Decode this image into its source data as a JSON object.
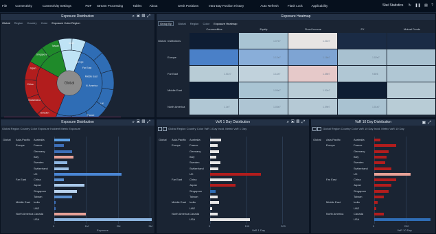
{
  "menu": [
    "File",
    "Connectivity",
    "Connectivity Settings",
    "PDF",
    "Stream Processing",
    "Tables",
    "About",
    "",
    "Desk Positions",
    "Intra-Day Position History",
    "Auto Refresh",
    "Flash Lock",
    "Applicability"
  ],
  "top_right": {
    "label": "Stat Statistics",
    "icons": [
      "refresh-icon",
      "pause-icon",
      "chart-icon",
      "help-icon"
    ]
  },
  "p1": {
    "title": "Exposure Distribution",
    "controls": {
      "items": [
        "Global",
        "Region",
        "Country"
      ],
      "color_label": "Color",
      "color_value": "Exposure Color Region"
    }
  },
  "sunburst": {
    "center": "Global",
    "regions": [
      {
        "name": "Europe",
        "value": 50,
        "color": "#2f6db5"
      },
      {
        "name": "Far East",
        "value": 27,
        "color": "#b21d1d"
      },
      {
        "name": "Middle East",
        "value": 13,
        "color": "#1f8a2a"
      },
      {
        "name": "North America",
        "value": 10,
        "color": "#bfe3f5"
      }
    ],
    "outer_labels": [
      "Europe",
      "Far East",
      "Middle East",
      "N. America",
      "UK",
      "France",
      "Germany",
      "Italy",
      "Sweden",
      "Switzerland",
      "China",
      "Japan",
      "Singapore",
      "Taiwan",
      "Israel"
    ]
  },
  "p2": {
    "title": "Exposure Heatmap",
    "controls": {
      "select": "Group By",
      "items": [
        "Global",
        "Region"
      ],
      "color_label": "Color",
      "color_value": "Exposure Heatmap"
    },
    "columns": [
      "Commodities",
      "Equity",
      "Fixed Income",
      "FX",
      "Mutual Funds"
    ],
    "rows": [
      {
        "group": "Global",
        "label": "Institutions",
        "cells": [
          "#0e1d33",
          "#a9c4d3",
          "#e7e4e3",
          "#1a2b45",
          "#1a2b45"
        ],
        "vals": [
          "",
          "1.07e7",
          "1.21e7",
          "",
          ""
        ]
      },
      {
        "group": "",
        "label": "Europe",
        "cells": [
          "#4a80c8",
          "#89aed9",
          "#7ea4d3",
          "#a8c1d0",
          "#a8c1d0"
        ],
        "vals": [
          "",
          "1.12e7",
          "1.18e7",
          "1.02e7",
          ""
        ]
      },
      {
        "group": "",
        "label": "Far East",
        "cells": [
          "#b8ccd6",
          "#c1d2dc",
          "#e6c9c9",
          "#b0c7d4",
          "#b0c7d4"
        ],
        "vals": [
          "1.01e7",
          "1.11e7",
          "1.35e7",
          "9.8e6",
          ""
        ]
      },
      {
        "group": "",
        "label": "Middle East",
        "cells": [
          "#0e1d33",
          "#a9c4d3",
          "#b9ccd6",
          "#0e1d33",
          "#b8ccd6"
        ],
        "vals": [
          "",
          "1.05e7",
          "1.02e7",
          "",
          ""
        ]
      },
      {
        "group": "",
        "label": "North America",
        "cells": [
          "#b0c7d4",
          "#aec5d3",
          "#b5c9d5",
          "#a9c2d1",
          "#b8ccd6"
        ],
        "vals": [
          "1.1e7",
          "1.04e7",
          "1.09e7",
          "1.01e7",
          ""
        ]
      }
    ]
  },
  "bars_panels": [
    {
      "title": "Exposure Distribution",
      "controls": "Global  Region  Country    Color  Exposure Incident  Metric  Exposure",
      "xticks": [
        "0",
        "1M",
        "2M",
        "3M"
      ],
      "xmax": 3.1,
      "xlabel": "Exposure",
      "rows": [
        {
          "region": "Global",
          "sub": "Asia-Pacific",
          "country": "Australia",
          "v": 0.5,
          "c": "#5ea3e8"
        },
        {
          "region": "",
          "sub": "Europe",
          "country": "France",
          "v": 0.3,
          "c": "#3d6fb8"
        },
        {
          "region": "",
          "sub": "",
          "country": "Germany",
          "v": 0.55,
          "c": "#3d6fb8"
        },
        {
          "region": "",
          "sub": "",
          "country": "Italy",
          "v": 0.6,
          "c": "#e8a298"
        },
        {
          "region": "",
          "sub": "",
          "country": "Sweden",
          "v": 0.4,
          "c": "#8db5e0"
        },
        {
          "region": "",
          "sub": "",
          "country": "Switzerland",
          "v": 0.45,
          "c": "#9cbfe3"
        },
        {
          "region": "",
          "sub": "",
          "country": "UK",
          "v": 2.1,
          "c": "#4a86d4"
        },
        {
          "region": "",
          "sub": "Far East",
          "country": "China",
          "v": 0.3,
          "c": "#5a8fd0"
        },
        {
          "region": "",
          "sub": "",
          "country": "Japan",
          "v": 0.95,
          "c": "#a9c9ea"
        },
        {
          "region": "",
          "sub": "",
          "country": "Singapore",
          "v": 0.7,
          "c": "#b9d3ee"
        },
        {
          "region": "",
          "sub": "",
          "country": "Taiwan",
          "v": 0.55,
          "c": "#5a8fd0"
        },
        {
          "region": "",
          "sub": "Middle East",
          "country": "India",
          "v": 0.05,
          "c": "#3d6fb8"
        },
        {
          "region": "",
          "sub": "",
          "country": "UAE",
          "v": 0.05,
          "c": "#3d6fb8"
        },
        {
          "region": "",
          "sub": "North America",
          "country": "Canada",
          "v": 1.0,
          "c": "#e8a298"
        },
        {
          "region": "",
          "sub": "",
          "country": "USA",
          "v": 3.05,
          "c": "#8db5e0"
        }
      ]
    },
    {
      "title": "VaR 1 Day Distribution",
      "controls": "Global  Region  Country    Color  VaR 1 Day Incid.   Metric  VaR 1 Day",
      "xticks": [
        "0",
        "100",
        "200"
      ],
      "xmax": 270,
      "xlabel": "VaR 1 Day",
      "rows": [
        {
          "region": "Global",
          "sub": "Asia-Pacific",
          "country": "Australia",
          "v": 30,
          "c": "#e6e6e6"
        },
        {
          "region": "",
          "sub": "Europe",
          "country": "France",
          "v": 20,
          "c": "#e6e6e6"
        },
        {
          "region": "",
          "sub": "",
          "country": "Germany",
          "v": 25,
          "c": "#e6e6e6"
        },
        {
          "region": "",
          "sub": "",
          "country": "Italy",
          "v": 18,
          "c": "#e6e6e6"
        },
        {
          "region": "",
          "sub": "",
          "country": "Sweden",
          "v": 28,
          "c": "#e6e6e6"
        },
        {
          "region": "",
          "sub": "",
          "country": "Switzerland",
          "v": 22,
          "c": "#e6e6e6"
        },
        {
          "region": "",
          "sub": "",
          "country": "UK",
          "v": 140,
          "c": "#b21d1d"
        },
        {
          "region": "",
          "sub": "Far East",
          "country": "China",
          "v": 60,
          "c": "#e6e6e6"
        },
        {
          "region": "",
          "sub": "",
          "country": "Japan",
          "v": 70,
          "c": "#b21d1d"
        },
        {
          "region": "",
          "sub": "",
          "country": "Singapore",
          "v": 15,
          "c": "#2f6db5"
        },
        {
          "region": "",
          "sub": "",
          "country": "Taiwan",
          "v": 20,
          "c": "#e6e6e6"
        },
        {
          "region": "",
          "sub": "Middle East",
          "country": "India",
          "v": 25,
          "c": "#e6e6e6"
        },
        {
          "region": "",
          "sub": "",
          "country": "UAE",
          "v": 5,
          "c": "#e6e6e6"
        },
        {
          "region": "",
          "sub": "North America",
          "country": "Canada",
          "v": 20,
          "c": "#e6e6e6"
        },
        {
          "region": "",
          "sub": "",
          "country": "USA",
          "v": 110,
          "c": "#e6e6e6"
        }
      ]
    },
    {
      "title": "VaR 10 Day Distribution",
      "controls": "Global  Region  Country    Color  VaR 10 Day Incid.  Metric  VaR 10 Day",
      "xticks": [
        "0",
        "200"
      ],
      "xmax": 380,
      "xlabel": "VaR 10 Day",
      "rows": [
        {
          "region": "Global",
          "sub": "Asia-Pacific",
          "country": "Australia",
          "v": 40,
          "c": "#b21d1d"
        },
        {
          "region": "",
          "sub": "Europe",
          "country": "France",
          "v": 140,
          "c": "#b21d1d"
        },
        {
          "region": "",
          "sub": "",
          "country": "Germany",
          "v": 90,
          "c": "#b21d1d"
        },
        {
          "region": "",
          "sub": "",
          "country": "Italy",
          "v": 80,
          "c": "#b21d1d"
        },
        {
          "region": "",
          "sub": "",
          "country": "Sweden",
          "v": 70,
          "c": "#b21d1d"
        },
        {
          "region": "",
          "sub": "",
          "country": "Switzerland",
          "v": 110,
          "c": "#b21d1d"
        },
        {
          "region": "",
          "sub": "",
          "country": "UK",
          "v": 230,
          "c": "#e8a298"
        },
        {
          "region": "",
          "sub": "Far East",
          "country": "China",
          "v": 140,
          "c": "#b21d1d"
        },
        {
          "region": "",
          "sub": "",
          "country": "Japan",
          "v": 110,
          "c": "#b21d1d"
        },
        {
          "region": "",
          "sub": "",
          "country": "Singapore",
          "v": 90,
          "c": "#b21d1d"
        },
        {
          "region": "",
          "sub": "",
          "country": "Taiwan",
          "v": 60,
          "c": "#b21d1d"
        },
        {
          "region": "",
          "sub": "Middle East",
          "country": "India",
          "v": 20,
          "c": "#b21d1d"
        },
        {
          "region": "",
          "sub": "",
          "country": "UAE",
          "v": 15,
          "c": "#b21d1d"
        },
        {
          "region": "",
          "sub": "North America",
          "country": "Canada",
          "v": 60,
          "c": "#b21d1d"
        },
        {
          "region": "",
          "sub": "",
          "country": "USA",
          "v": 360,
          "c": "#2f6db5"
        }
      ]
    }
  ]
}
